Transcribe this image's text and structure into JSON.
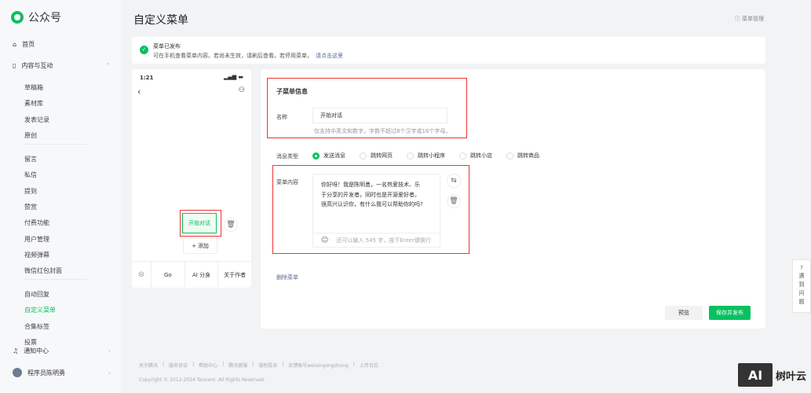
{
  "app": {
    "name": "公众号"
  },
  "sidebar": {
    "home": "首页",
    "content_group": "内容与互动",
    "items1": [
      "草稿箱",
      "素材库",
      "发表记录",
      "原创"
    ],
    "items2": [
      "留言",
      "私信",
      "提到",
      "赞赏",
      "付费功能",
      "用户管理",
      "视频弹幕",
      "微信红包封面"
    ],
    "items3": [
      "自动回复",
      "自定义菜单",
      "合集标签",
      "投票"
    ],
    "notify": "通知中心",
    "user": "程序员陈明勇"
  },
  "header": {
    "title": "自定义菜单",
    "menu_manage": "菜单管理"
  },
  "notice": {
    "title": "菜单已发布",
    "text": "可在手机查看菜单内容。若尚未生效，请刷后查看。若停用菜单，",
    "link": "请点击这里"
  },
  "phone": {
    "time": "1:21",
    "sub_menu": "开始对话",
    "add": "添加",
    "menus": [
      "Go",
      "AI 分身",
      "关于作者"
    ]
  },
  "editor": {
    "section_title": "子菜单信息",
    "name_label": "名称",
    "name_value": "开始对话",
    "name_hint": "仅支持中英文和数字，字数不超过8个汉字或16个字母。",
    "msg_type_label": "消息类型",
    "msg_types": [
      "发送消息",
      "跳转网页",
      "跳转小程序",
      "跳转小店",
      "跳转商品"
    ],
    "selected_type": "发送消息",
    "content_label": "菜单内容",
    "content_text": "你好呀！我是陈明勇，一名热爱技术、乐于分享的开发者，同时也是开源爱好者。很高兴认识你，有什么我可以帮助你的吗?",
    "content_hint": "还可以输入 545 字，按下Enter键换行",
    "delete_menu": "删除菜单",
    "preview": "预览",
    "save": "保存并发布"
  },
  "footer": {
    "links": [
      "关于腾讯",
      "服务协议",
      "帮助中心",
      "腾讯客服",
      "侵权投诉",
      "反馈账号weixingongzhong",
      "上传日志"
    ],
    "copyright": "Copyright © 2012-2024 Tencent. All Rights Reserved."
  },
  "help": {
    "label": [
      "遇",
      "到",
      "问",
      "题"
    ]
  },
  "watermark": "树叶云",
  "colors": {
    "accent": "#07c160",
    "link": "#576b95",
    "highlight_box": "#e33333"
  }
}
